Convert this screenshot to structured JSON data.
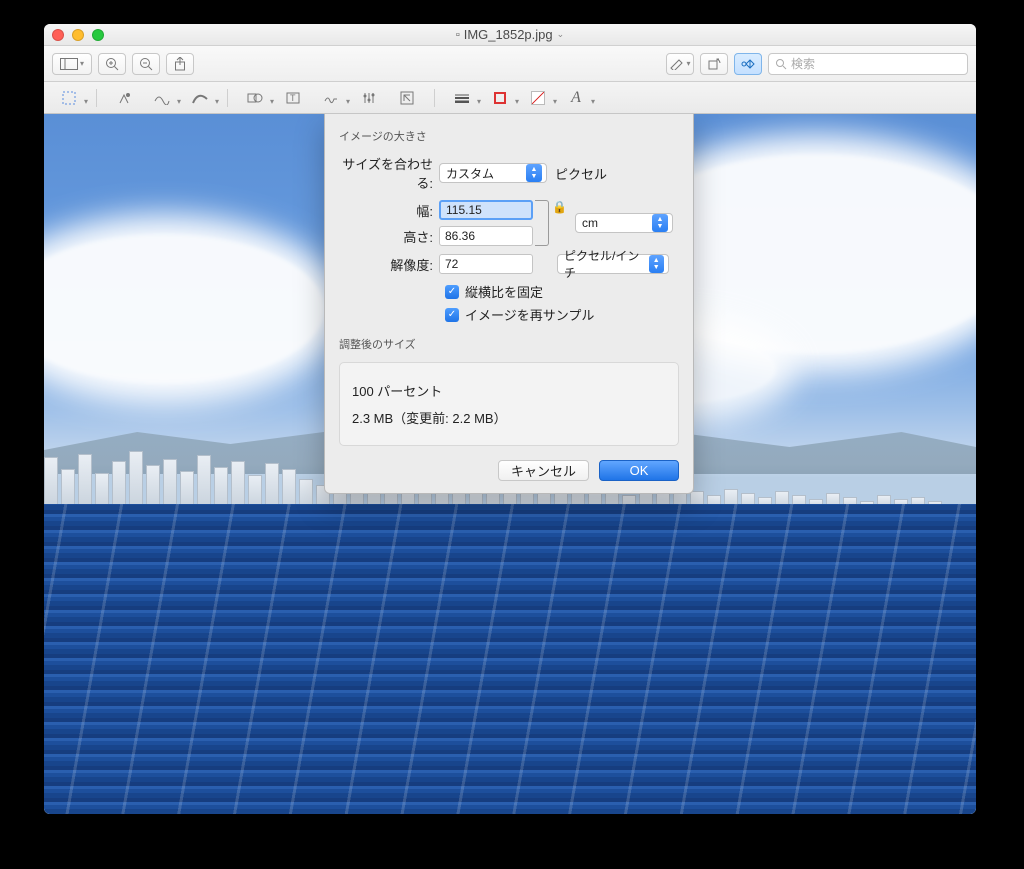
{
  "window": {
    "title": "IMG_1852p.jpg"
  },
  "toolbar1": {
    "search_placeholder": "検索"
  },
  "dialog": {
    "section_title": "イメージの大きさ",
    "fit_label": "サイズを合わせる:",
    "fit_value": "カスタム",
    "fit_unit": "ピクセル",
    "width_label": "幅:",
    "width_value": "115.15",
    "height_label": "高さ:",
    "height_value": "86.36",
    "dim_unit": "cm",
    "res_label": "解像度:",
    "res_value": "72",
    "res_unit": "ピクセル/インチ",
    "check_aspect": "縦横比を固定",
    "check_resample": "イメージを再サンプル",
    "result_title": "調整後のサイズ",
    "result_percent": "100 パーセント",
    "result_size": "2.3 MB（変更前: 2.2 MB）",
    "cancel": "キャンセル",
    "ok": "OK"
  }
}
